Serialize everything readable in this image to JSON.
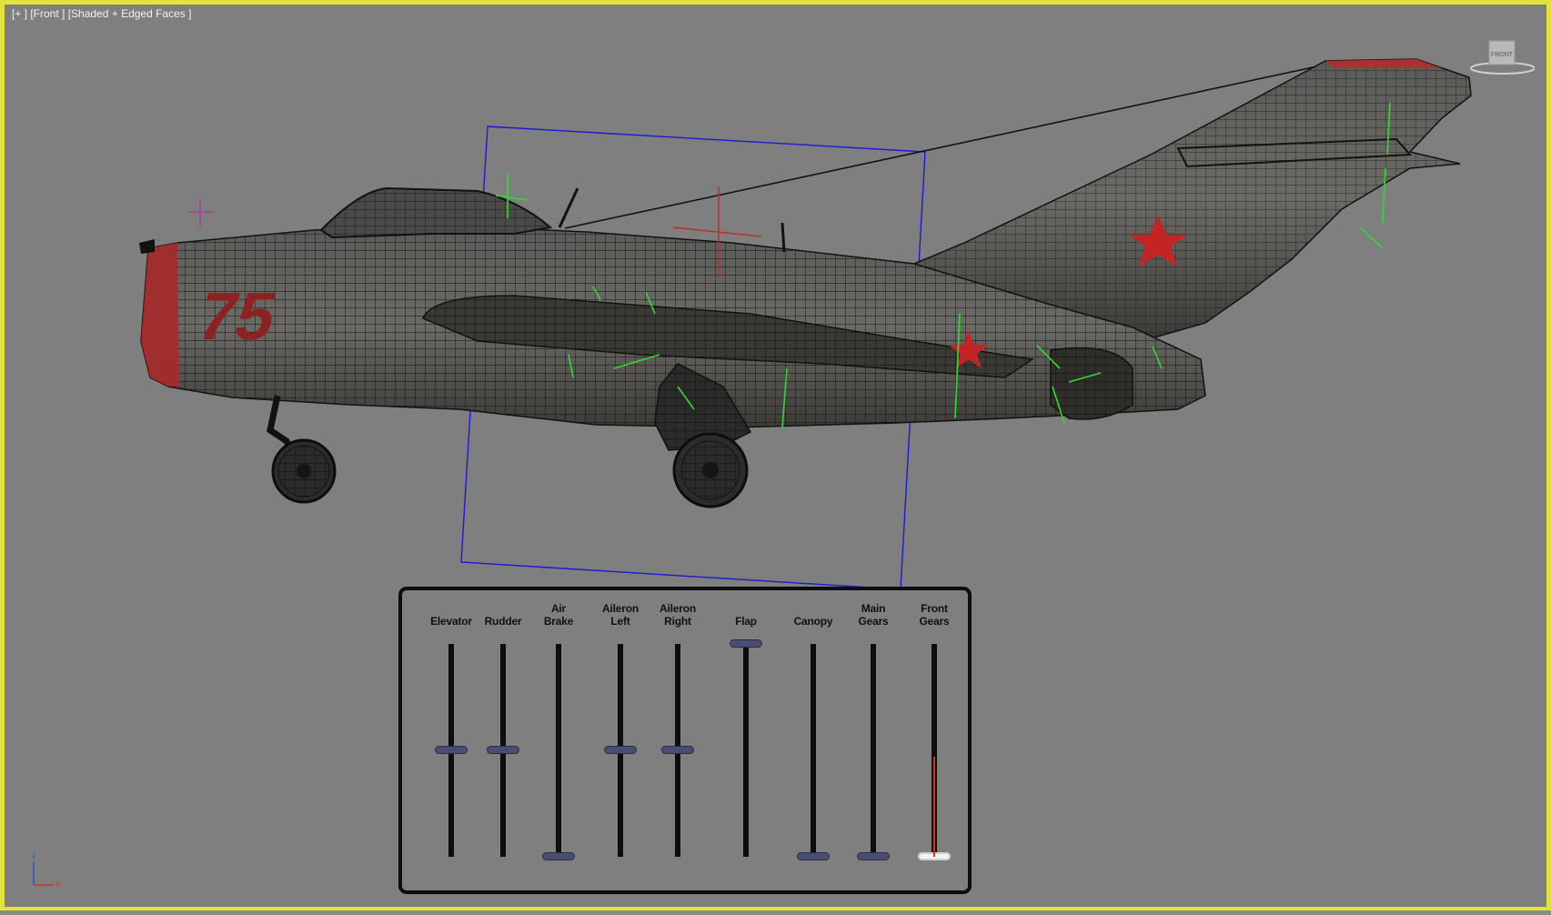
{
  "viewport": {
    "label": "[+ ] [Front ] [Shaded + Edged Faces ]",
    "border_color": "#e2e23c",
    "background": "#7f7f7f"
  },
  "viewcube": {
    "face_label": "FRONT"
  },
  "fuselage_number": "75",
  "axis_tripod": {
    "z_label": "z",
    "x_label": "x"
  },
  "control_panel": {
    "sliders": [
      {
        "id": "elevator",
        "label": "Elevator",
        "value": 0.5
      },
      {
        "id": "rudder",
        "label": "Rudder",
        "value": 0.5
      },
      {
        "id": "air-brake",
        "label": "Air\nBrake",
        "value": 0.0
      },
      {
        "id": "aileron-left",
        "label": "Aileron\nLeft",
        "value": 0.5
      },
      {
        "id": "aileron-right",
        "label": "Aileron\nRight",
        "value": 0.5
      },
      {
        "id": "flap",
        "label": "Flap",
        "value": 1.0
      },
      {
        "id": "canopy",
        "label": "Canopy",
        "value": 0.0
      },
      {
        "id": "main-gears",
        "label": "Main\nGears",
        "value": 0.0
      },
      {
        "id": "front-gears",
        "label": "Front\nGears",
        "value": 0.0,
        "selected": true
      }
    ]
  }
}
